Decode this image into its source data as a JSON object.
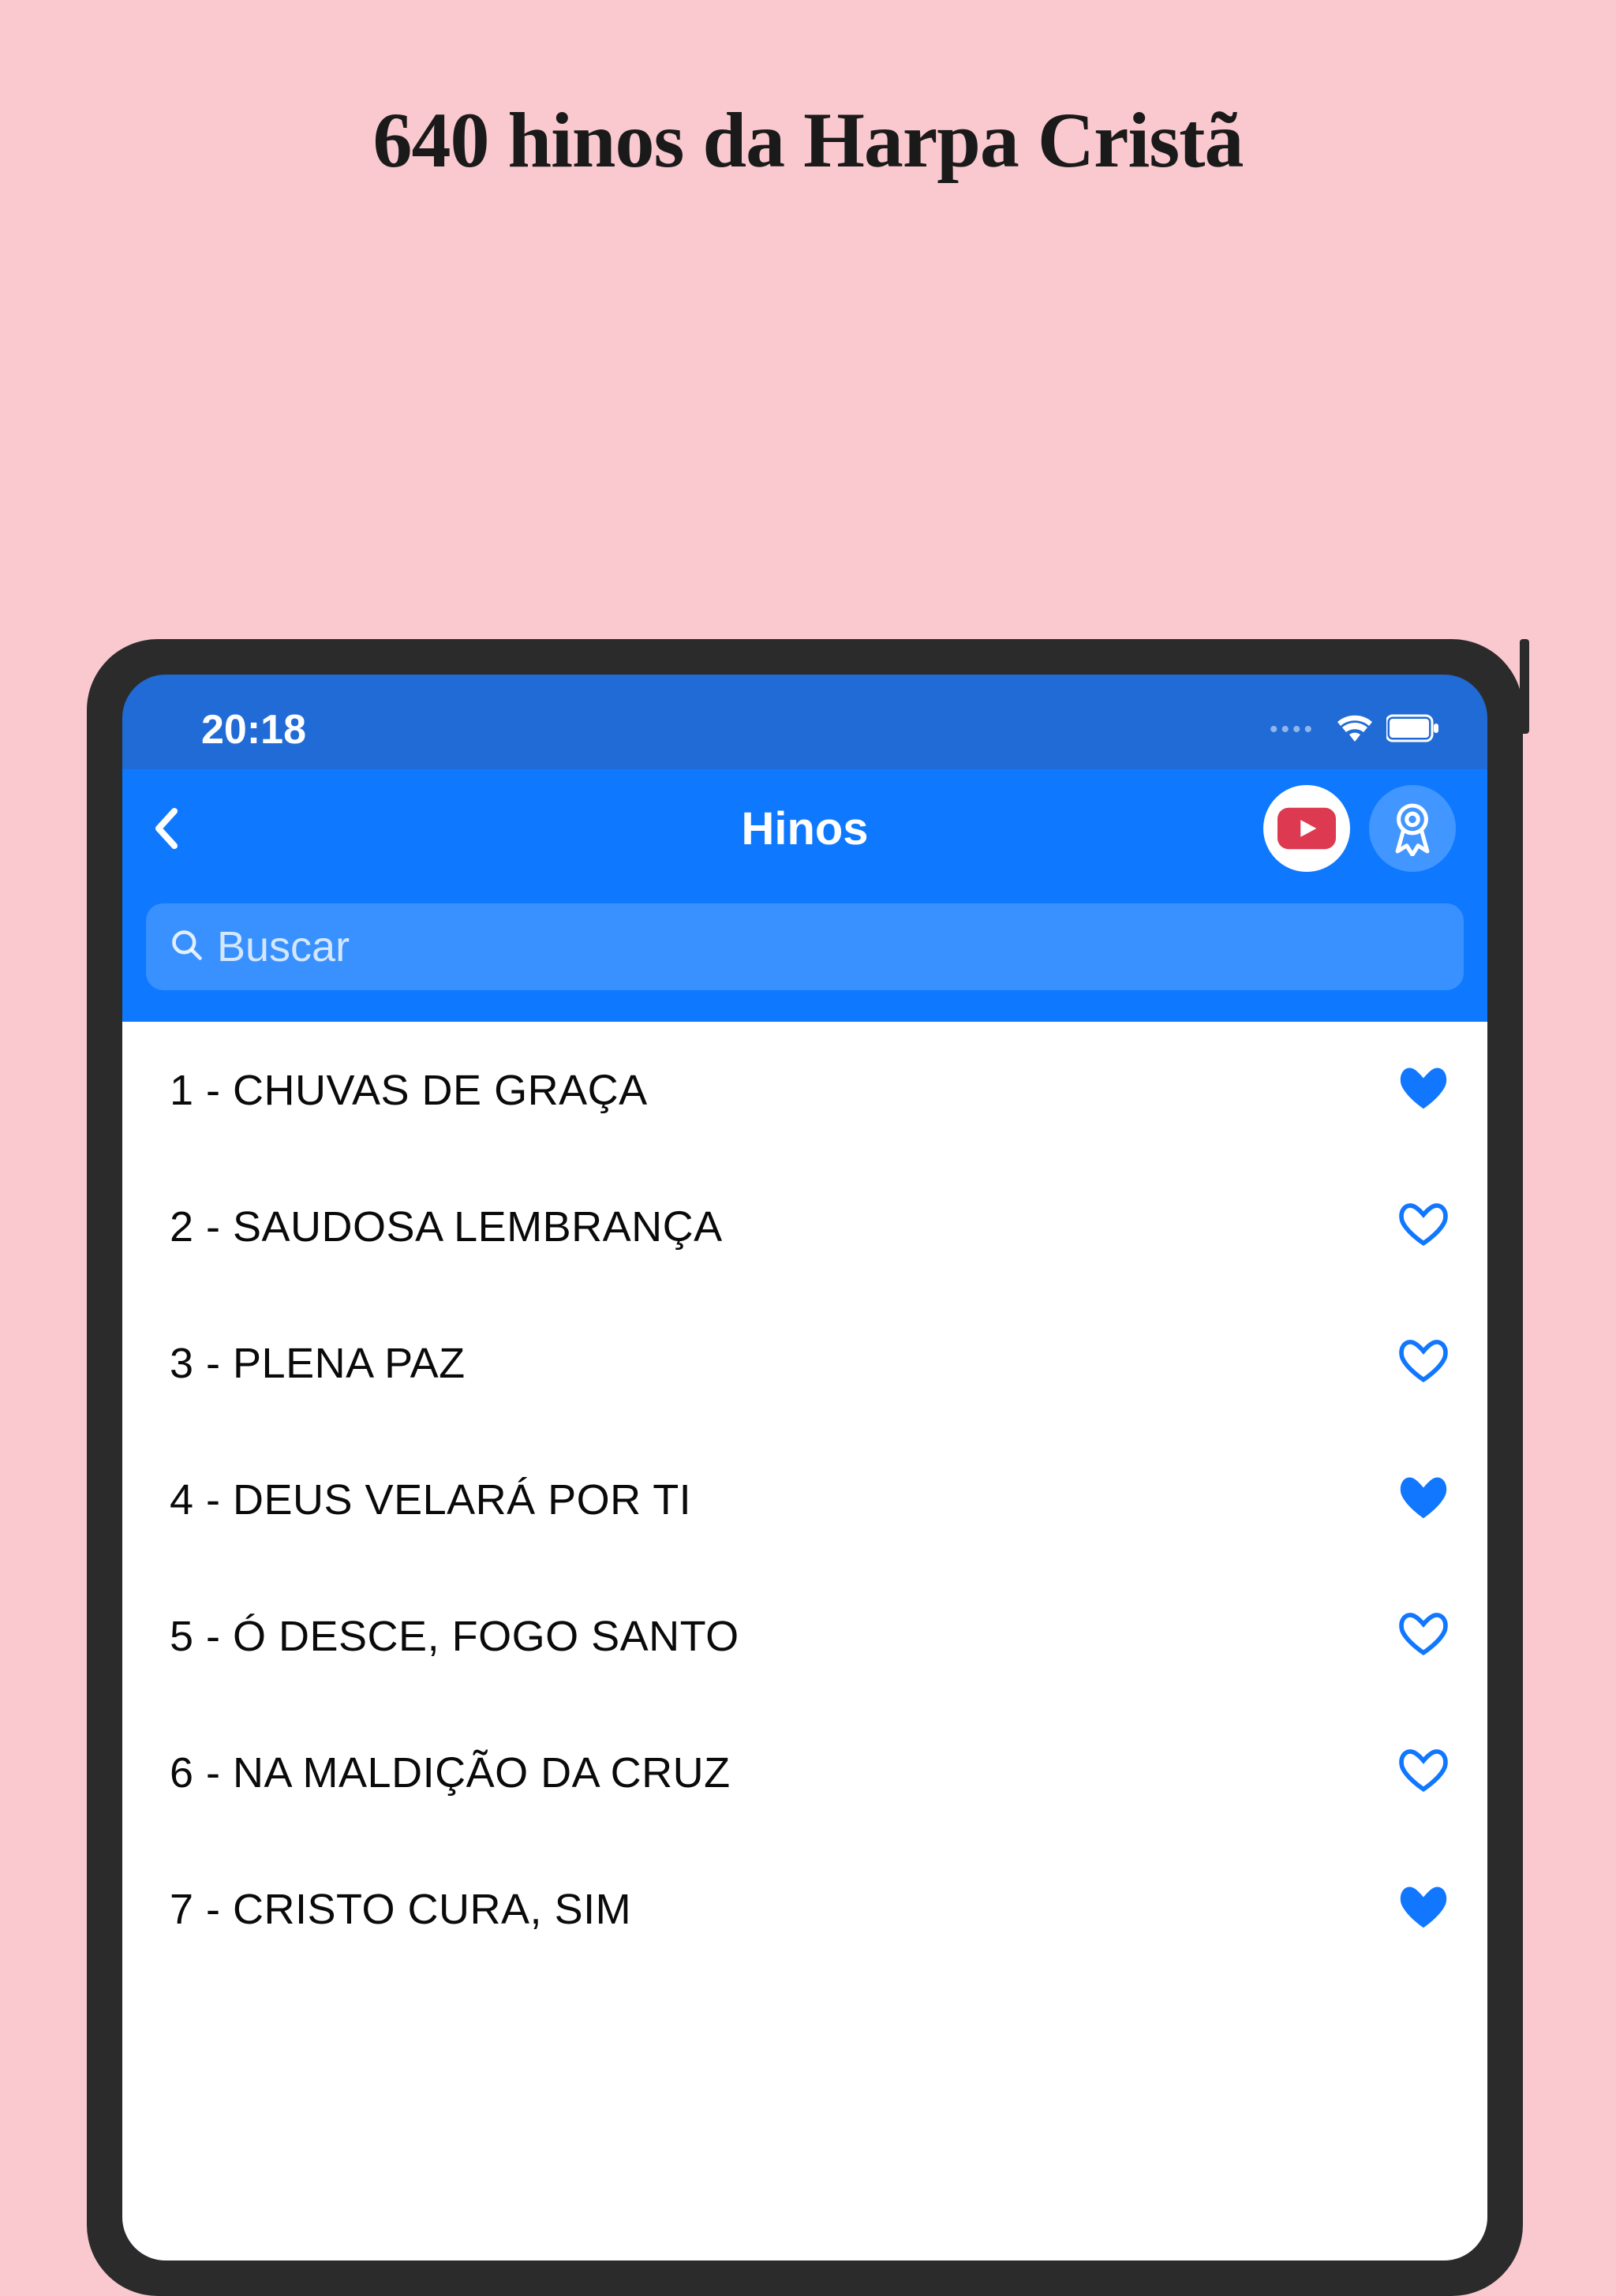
{
  "headline": "640 hinos da Harpa Cristã",
  "statusBar": {
    "time": "20:18"
  },
  "nav": {
    "title": "Hinos"
  },
  "search": {
    "placeholder": "Buscar"
  },
  "hymns": [
    {
      "label": "1 - CHUVAS DE GRAÇA",
      "favorite": true
    },
    {
      "label": "2 - SAUDOSA LEMBRANÇA",
      "favorite": false
    },
    {
      "label": "3 - PLENA PAZ",
      "favorite": false
    },
    {
      "label": "4 - DEUS VELARÁ POR TI",
      "favorite": true
    },
    {
      "label": "5 - Ó DESCE, FOGO SANTO",
      "favorite": false
    },
    {
      "label": "6 - NA MALDIÇÃO DA CRUZ",
      "favorite": false
    },
    {
      "label": "7 - CRISTO CURA, SIM",
      "favorite": true
    }
  ],
  "colors": {
    "accent": "#0e79ff",
    "heart": "#1177ff"
  }
}
